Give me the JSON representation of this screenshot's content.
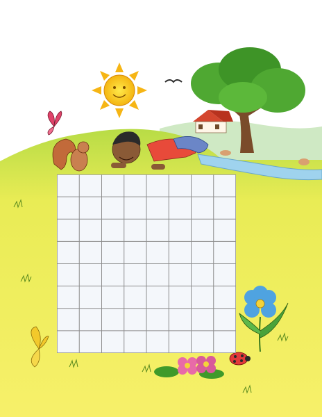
{
  "illustration": {
    "colors": {
      "sky": "#ffffff",
      "grass_light": "#f3ee5a",
      "grass_dark": "#9fcf3a",
      "river": "#9fd3ee",
      "grid_line": "#8d8d8d",
      "grid_fill": "#f4f7fb"
    },
    "grid": {
      "rows": 8,
      "cols": 8
    },
    "decorations": [
      "sun-icon",
      "bird-icon",
      "house-icon",
      "tree-icon",
      "river",
      "boy-character",
      "squirrel-icon",
      "butterfly-icon",
      "ladybug-icon",
      "blue-flower-icon",
      "pink-flowers-icon",
      "yellow-butterfly-icon"
    ]
  }
}
